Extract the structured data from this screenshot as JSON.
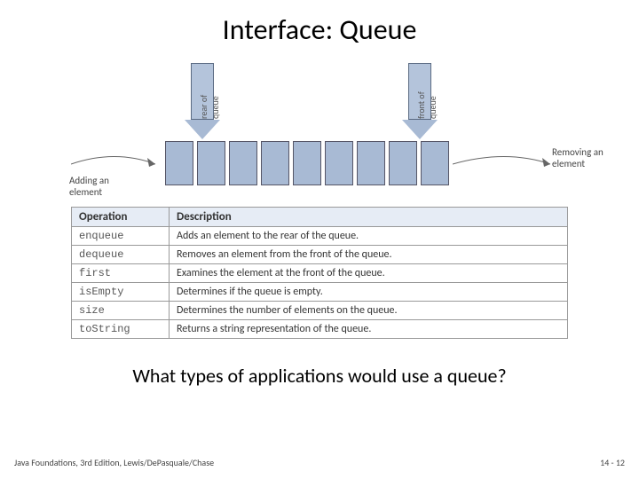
{
  "title": "Interface: Queue",
  "diagram": {
    "rear_label": "rear of queue",
    "front_label": "front of queue",
    "add_label": "Adding an\nelement",
    "remove_label": "Removing an\nelement"
  },
  "table": {
    "headers": {
      "op": "Operation",
      "desc": "Description"
    },
    "rows": [
      {
        "op": "enqueue",
        "desc": "Adds an element to the rear of the queue."
      },
      {
        "op": "dequeue",
        "desc": "Removes an element from the front of the queue."
      },
      {
        "op": "first",
        "desc": "Examines the element at the front of the queue."
      },
      {
        "op": "isEmpty",
        "desc": "Determines if the queue is empty."
      },
      {
        "op": "size",
        "desc": "Determines the number of elements on the queue."
      },
      {
        "op": "toString",
        "desc": "Returns a string representation of the queue."
      }
    ]
  },
  "question": "What types of applications would use a queue?",
  "footer": {
    "left": "Java Foundations, 3rd Edition, Lewis/DePasquale/Chase",
    "right": "14 - 12"
  }
}
